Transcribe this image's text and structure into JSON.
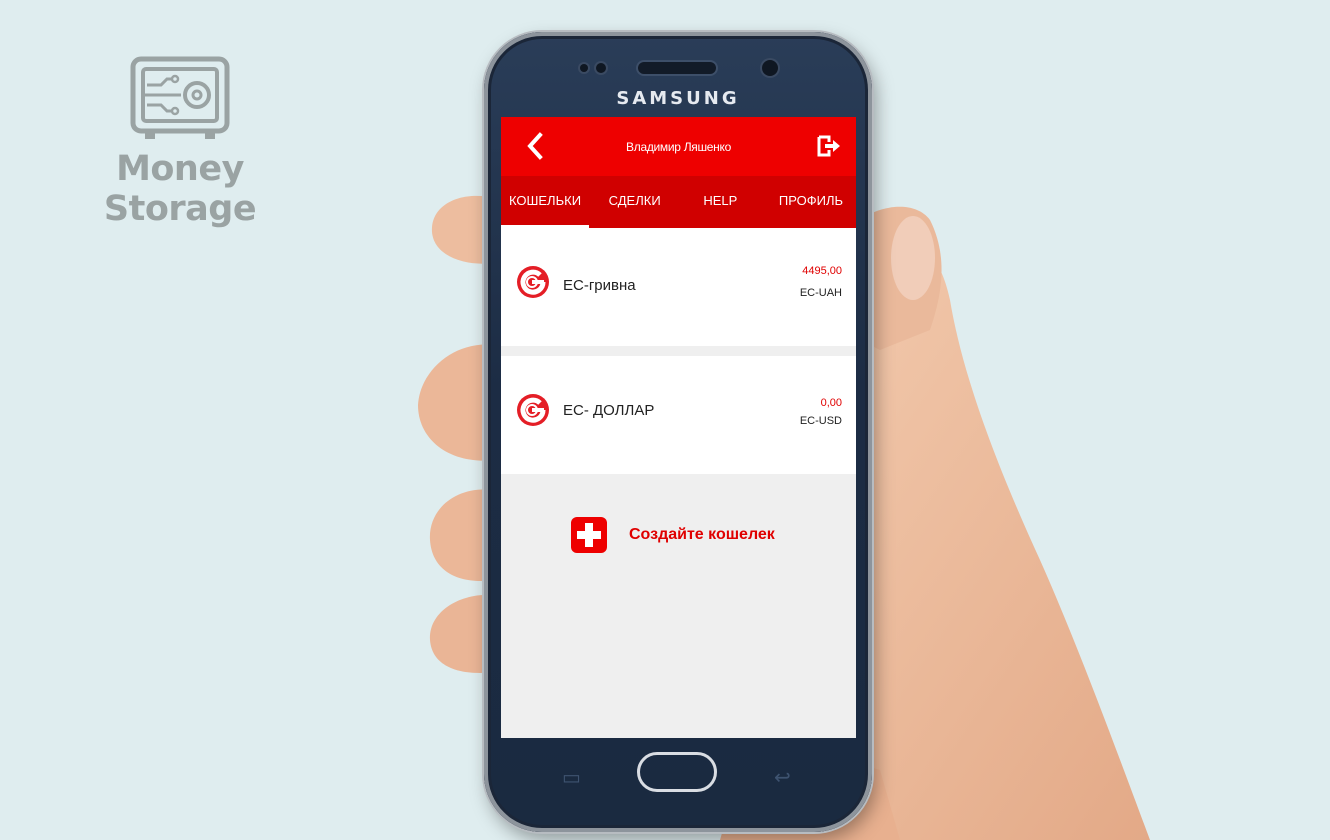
{
  "brand": {
    "name": "Money Storage",
    "icon": "safe-circuit-icon"
  },
  "device": {
    "maker": "SAMSUNG"
  },
  "app": {
    "user_name": "Владимир Ляшенко",
    "back_icon": "chevron-left-icon",
    "logout_icon": "logout-icon",
    "tabs": [
      {
        "label": "КОШЕЛЬКИ",
        "active": true
      },
      {
        "label": "СДЕЛКИ",
        "active": false
      },
      {
        "label": "HELP",
        "active": false
      },
      {
        "label": "ПРОФИЛЬ",
        "active": false
      }
    ],
    "wallets": [
      {
        "name": "EC-гривна",
        "amount": "4495,00",
        "code": "EC-UAH"
      },
      {
        "name": "EC- ДОЛЛАР",
        "amount": "0,00",
        "code": "EC-USD"
      }
    ],
    "create_wallet_label": "Создайте кошелек",
    "colors": {
      "primary": "#ee0000",
      "tabbar": "#d00000",
      "text": "#222222"
    }
  }
}
